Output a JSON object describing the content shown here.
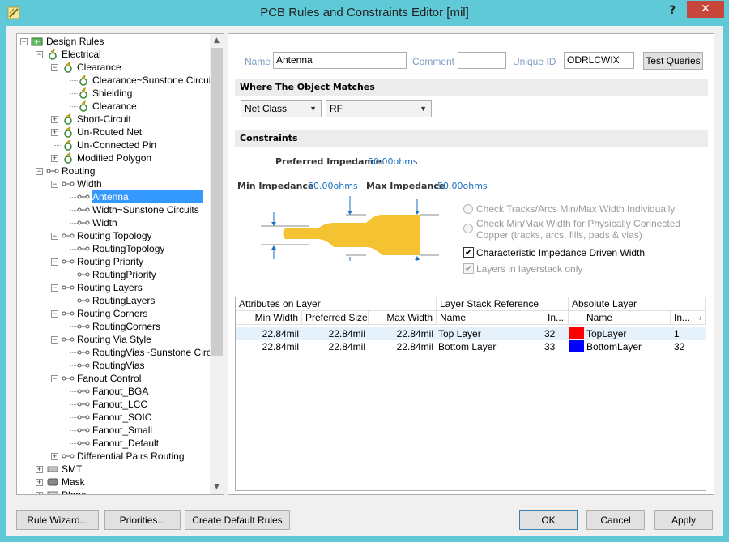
{
  "window": {
    "title": "PCB Rules and Constraints Editor [mil]",
    "help": "?",
    "close": "✕"
  },
  "tree": [
    {
      "label": "Design Rules",
      "level": 0,
      "expander": "-",
      "icon": "rules-icon"
    },
    {
      "label": "Electrical",
      "level": 1,
      "expander": "-",
      "icon": "electrical-icon"
    },
    {
      "label": "Clearance",
      "level": 2,
      "expander": "-",
      "icon": "clearance-icon"
    },
    {
      "label": "Clearance~Sunstone Circuits",
      "level": 3,
      "expander": "",
      "icon": "clearance-icon"
    },
    {
      "label": "Shielding",
      "level": 3,
      "expander": "",
      "icon": "clearance-icon"
    },
    {
      "label": "Clearance",
      "level": 3,
      "expander": "",
      "icon": "clearance-icon"
    },
    {
      "label": "Short-Circuit",
      "level": 2,
      "expander": "+",
      "icon": "clearance-icon"
    },
    {
      "label": "Un-Routed Net",
      "level": 2,
      "expander": "+",
      "icon": "clearance-icon"
    },
    {
      "label": "Un-Connected Pin",
      "level": 2,
      "expander": "",
      "icon": "clearance-icon"
    },
    {
      "label": "Modified Polygon",
      "level": 2,
      "expander": "+",
      "icon": "clearance-icon"
    },
    {
      "label": "Routing",
      "level": 1,
      "expander": "-",
      "icon": "routing-icon"
    },
    {
      "label": "Width",
      "level": 2,
      "expander": "-",
      "icon": "routing-icon"
    },
    {
      "label": "Antenna",
      "level": 3,
      "expander": "",
      "icon": "routing-icon",
      "selected": true
    },
    {
      "label": "Width~Sunstone Circuits",
      "level": 3,
      "expander": "",
      "icon": "routing-icon"
    },
    {
      "label": "Width",
      "level": 3,
      "expander": "",
      "icon": "routing-icon"
    },
    {
      "label": "Routing Topology",
      "level": 2,
      "expander": "-",
      "icon": "routing-icon"
    },
    {
      "label": "RoutingTopology",
      "level": 3,
      "expander": "",
      "icon": "routing-icon"
    },
    {
      "label": "Routing Priority",
      "level": 2,
      "expander": "-",
      "icon": "routing-icon"
    },
    {
      "label": "RoutingPriority",
      "level": 3,
      "expander": "",
      "icon": "routing-icon"
    },
    {
      "label": "Routing Layers",
      "level": 2,
      "expander": "-",
      "icon": "routing-icon"
    },
    {
      "label": "RoutingLayers",
      "level": 3,
      "expander": "",
      "icon": "routing-icon"
    },
    {
      "label": "Routing Corners",
      "level": 2,
      "expander": "-",
      "icon": "routing-icon"
    },
    {
      "label": "RoutingCorners",
      "level": 3,
      "expander": "",
      "icon": "routing-icon"
    },
    {
      "label": "Routing Via Style",
      "level": 2,
      "expander": "-",
      "icon": "routing-icon"
    },
    {
      "label": "RoutingVias~Sunstone Circuits",
      "level": 3,
      "expander": "",
      "icon": "routing-icon"
    },
    {
      "label": "RoutingVias",
      "level": 3,
      "expander": "",
      "icon": "routing-icon"
    },
    {
      "label": "Fanout Control",
      "level": 2,
      "expander": "-",
      "icon": "routing-icon"
    },
    {
      "label": "Fanout_BGA",
      "level": 3,
      "expander": "",
      "icon": "routing-icon"
    },
    {
      "label": "Fanout_LCC",
      "level": 3,
      "expander": "",
      "icon": "routing-icon"
    },
    {
      "label": "Fanout_SOIC",
      "level": 3,
      "expander": "",
      "icon": "routing-icon"
    },
    {
      "label": "Fanout_Small",
      "level": 3,
      "expander": "",
      "icon": "routing-icon"
    },
    {
      "label": "Fanout_Default",
      "level": 3,
      "expander": "",
      "icon": "routing-icon"
    },
    {
      "label": "Differential Pairs Routing",
      "level": 2,
      "expander": "+",
      "icon": "routing-icon"
    },
    {
      "label": "SMT",
      "level": 1,
      "expander": "+",
      "icon": "smt-icon"
    },
    {
      "label": "Mask",
      "level": 1,
      "expander": "+",
      "icon": "mask-icon"
    },
    {
      "label": "Plane",
      "level": 1,
      "expander": "+",
      "icon": "plane-icon"
    }
  ],
  "header": {
    "name_label": "Name",
    "name_value": "Antenna",
    "comment_label": "Comment",
    "comment_value": "",
    "uid_label": "Unique ID",
    "uid_value": "ODRLCWIX",
    "test_queries": "Test Queries"
  },
  "where": {
    "title": "Where The Object Matches",
    "scope": "Net Class",
    "value": "RF"
  },
  "constraints": {
    "title": "Constraints",
    "preferred_label": "Preferred Impedance",
    "preferred_value": "50.00ohms",
    "min_label": "Min Impedance",
    "min_value": "50.00ohms",
    "max_label": "Max Impedance",
    "max_value": "50.00ohms",
    "opt1": "Check Tracks/Arcs Min/Max Width Individually",
    "opt2a": "Check Min/Max Width for Physically Connected",
    "opt2b": "Copper (tracks, arcs, fills, pads & vias)",
    "opt3": "Characteristic Impedance Driven Width",
    "opt3_checked": true,
    "opt4": "Layers in layerstack only",
    "opt4_checked": true,
    "track_color": "#f5c232"
  },
  "grid": {
    "group1": "Attributes on Layer",
    "group2": "Layer Stack Reference",
    "group3": "Absolute Layer",
    "cols": [
      "Min Width",
      "Preferred Size",
      "Max Width",
      "Name",
      "In...",
      "Name",
      "In..."
    ],
    "rows": [
      {
        "min": "22.84mil",
        "pref": "22.84mil",
        "max": "22.84mil",
        "ref_name": "Top Layer",
        "ref_idx": "32",
        "color": "#ff0000",
        "abs_name": "TopLayer",
        "abs_idx": "1"
      },
      {
        "min": "22.84mil",
        "pref": "22.84mil",
        "max": "22.84mil",
        "ref_name": "Bottom Layer",
        "ref_idx": "33",
        "color": "#0000ff",
        "abs_name": "BottomLayer",
        "abs_idx": "32"
      }
    ]
  },
  "buttons": {
    "wizard": "Rule Wizard...",
    "priorities": "Priorities...",
    "create_default": "Create Default Rules",
    "ok": "OK",
    "cancel": "Cancel",
    "apply": "Apply"
  }
}
